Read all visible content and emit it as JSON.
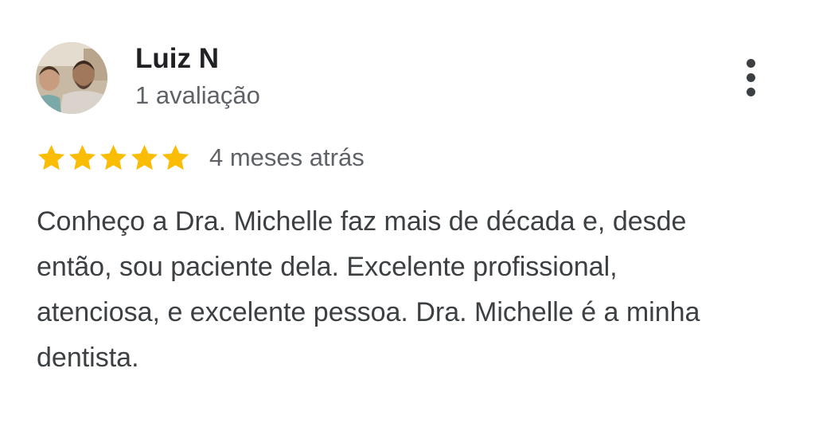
{
  "review": {
    "reviewer_name": "Luiz N",
    "review_count": "1 avaliação",
    "rating": 5,
    "rating_max": 5,
    "time_ago": "4 meses atrás",
    "text": "Conheço a Dra. Michelle faz mais de década e, desde então, sou paciente dela. Excelente profissional, atenciosa, e excelente pessoa. Dra. Michelle é a minha dentista."
  },
  "icons": {
    "star": "star-icon",
    "more": "more-vertical-icon",
    "avatar": "avatar-photo"
  },
  "colors": {
    "star": "#fbbc04",
    "name": "#202124",
    "secondary": "#5f6368",
    "body_text": "#3c4043"
  }
}
